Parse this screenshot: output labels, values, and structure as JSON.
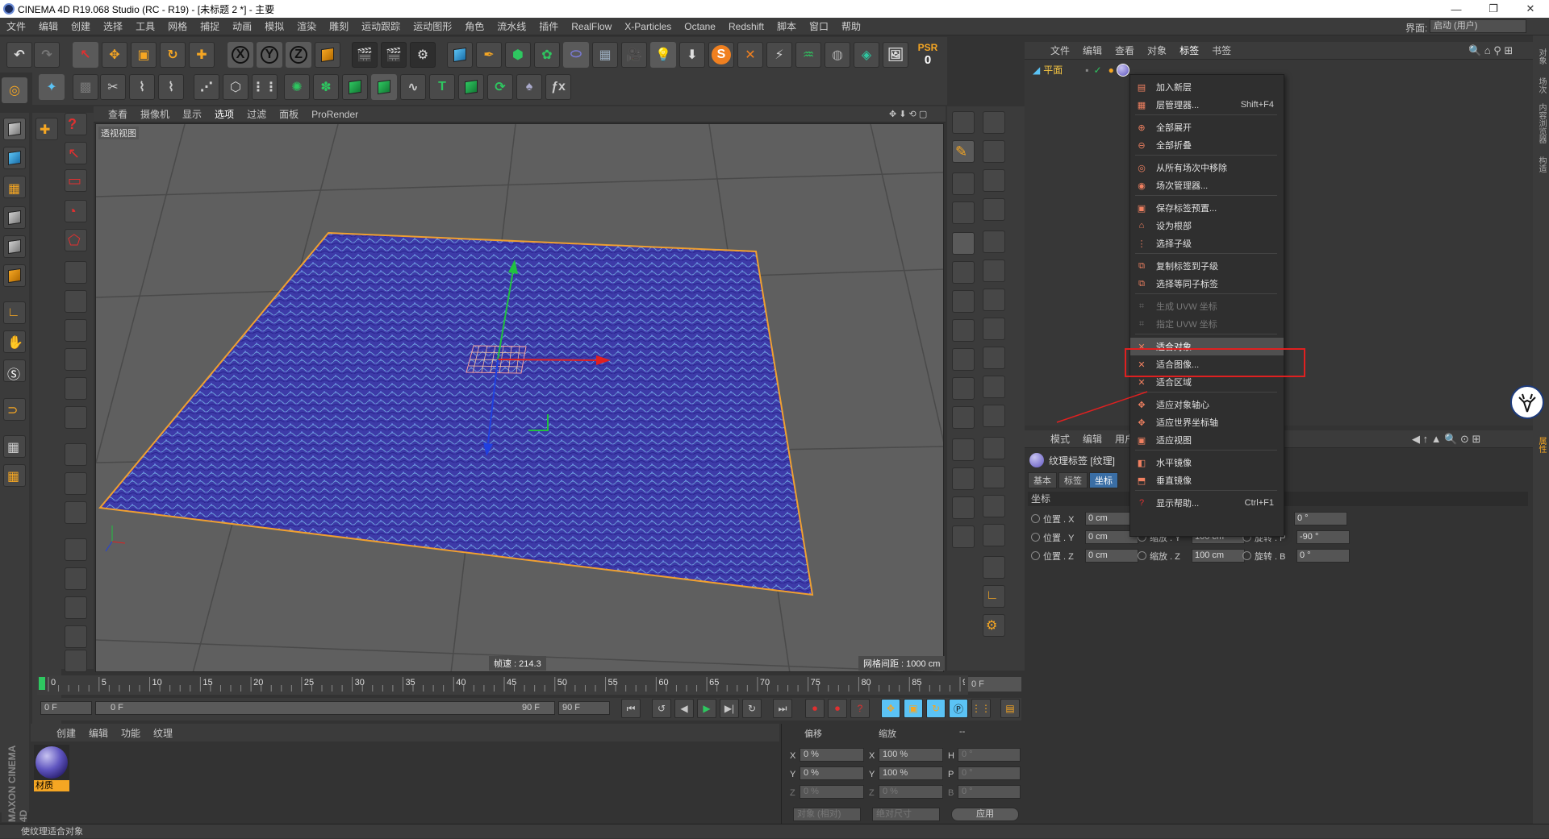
{
  "window": {
    "title": "CINEMA 4D R19.068 Studio (RC - R19) - [未标题 2 *] - 主要",
    "min": "—",
    "restore": "❐",
    "close": "✕"
  },
  "menubar": {
    "items": [
      "文件",
      "编辑",
      "创建",
      "选择",
      "工具",
      "网格",
      "捕捉",
      "动画",
      "模拟",
      "渲染",
      "雕刻",
      "运动跟踪",
      "运动图形",
      "角色",
      "流水线",
      "插件",
      "RealFlow",
      "X-Particles",
      "Octane",
      "Redshift",
      "脚本",
      "窗口",
      "帮助"
    ],
    "layout_label": "界面:",
    "layout_value": "启动 (用户)"
  },
  "toolbar": {
    "psr_label": "PSR",
    "psr_value": "0",
    "x": "X",
    "y": "Y",
    "z": "Z"
  },
  "viewport": {
    "menu": [
      "查看",
      "摄像机",
      "显示",
      "选项",
      "过滤",
      "面板",
      "ProRender"
    ],
    "active": "选项",
    "title": "透视视图",
    "speed": "帧速 : 214.3",
    "grid": "网格间距 : 1000 cm",
    "colors": {
      "plane": "#3d3aa8",
      "edge": "#f0a030",
      "x_axis": "#e02020",
      "y_axis": "#20c040",
      "z_axis": "#2040e0"
    }
  },
  "timeline": {
    "ticks": [
      "0",
      "5",
      "10",
      "15",
      "20",
      "25",
      "30",
      "35",
      "40",
      "45",
      "50",
      "55",
      "60",
      "65",
      "70",
      "75",
      "80",
      "85",
      "90"
    ],
    "current": "0 F"
  },
  "transport": {
    "start": "0 F",
    "range_start": "0 F",
    "range_end": "90 F",
    "end": "90 F"
  },
  "material_manager": {
    "menu": [
      "创建",
      "编辑",
      "功能",
      "纹理"
    ],
    "material_name": "材质"
  },
  "coord_manager": {
    "headers": [
      "偏移",
      "缩放",
      "--"
    ],
    "rows": [
      {
        "axis": "X",
        "off": "0 %",
        "ax2": "X",
        "scale": "100 %",
        "ax3": "H",
        "rot": "0 °"
      },
      {
        "axis": "Y",
        "off": "0 %",
        "ax2": "Y",
        "scale": "100 %",
        "ax3": "P",
        "rot": "0 °"
      },
      {
        "axis": "Z",
        "off": "0 %",
        "ax2": "Z",
        "scale": "0 %",
        "ax3": "B",
        "rot": "0 °"
      }
    ],
    "mode": "对象 (相对)",
    "size_mode": "绝对尺寸",
    "apply": "应用"
  },
  "object_manager": {
    "menu": [
      "文件",
      "编辑",
      "查看",
      "对象",
      "标签",
      "书签"
    ],
    "active": "标签",
    "object_name": "平面"
  },
  "attribute_manager": {
    "menu": [
      "模式",
      "编辑",
      "用户数"
    ],
    "title": "纹理标签 [纹理]",
    "tabs": [
      "基本",
      "标签",
      "坐标"
    ],
    "active_tab": "坐标",
    "section": "坐标",
    "rows": [
      {
        "l1": "位置 . X",
        "v1": "0 cm",
        "l2": "",
        "v2": "",
        "l3": "",
        "v3": "0 °"
      },
      {
        "l1": "位置 . Y",
        "v1": "0 cm",
        "l2": "缩放 . Y",
        "v2": "100 cm",
        "l3": "旋转 . P",
        "v3": "-90 °"
      },
      {
        "l1": "位置 . Z",
        "v1": "0 cm",
        "l2": "缩放 . Z",
        "v2": "100 cm",
        "l3": "旋转 . B",
        "v3": "0 °"
      }
    ]
  },
  "context_menu": {
    "items": [
      {
        "label": "加入新层",
        "shortcut": "",
        "disabled": false,
        "icon": "layer-add-icon"
      },
      {
        "label": "层管理器...",
        "shortcut": "Shift+F4",
        "disabled": false,
        "icon": "layer-manager-icon"
      },
      {
        "label": "全部展开",
        "shortcut": "",
        "disabled": false,
        "icon": "expand-all-icon"
      },
      {
        "label": "全部折叠",
        "shortcut": "",
        "disabled": false,
        "icon": "collapse-all-icon"
      },
      {
        "label": "从所有场次中移除",
        "shortcut": "",
        "disabled": false,
        "icon": "remove-takes-icon"
      },
      {
        "label": "场次管理器...",
        "shortcut": "",
        "disabled": false,
        "icon": "take-manager-icon"
      },
      {
        "label": "保存标签预置...",
        "shortcut": "",
        "disabled": false,
        "icon": "save-preset-icon"
      },
      {
        "label": "设为根部",
        "shortcut": "",
        "disabled": false,
        "icon": "set-root-icon"
      },
      {
        "label": "选择子级",
        "shortcut": "",
        "disabled": false,
        "icon": "select-children-icon"
      },
      {
        "label": "复制标签到子级",
        "shortcut": "",
        "disabled": false,
        "icon": "copy-tag-icon"
      },
      {
        "label": "选择等同子标签",
        "shortcut": "",
        "disabled": false,
        "icon": "select-same-icon"
      },
      {
        "label": "生成 UVW 坐标",
        "shortcut": "",
        "disabled": true,
        "icon": "generate-uvw-icon"
      },
      {
        "label": "指定 UVW 坐标",
        "shortcut": "",
        "disabled": true,
        "icon": "assign-uvw-icon"
      },
      {
        "label": "适合对象",
        "shortcut": "",
        "disabled": false,
        "icon": "fit-object-icon",
        "selected": true
      },
      {
        "label": "适合图像...",
        "shortcut": "",
        "disabled": false,
        "icon": "fit-image-icon"
      },
      {
        "label": "适合区域",
        "shortcut": "",
        "disabled": false,
        "icon": "fit-region-icon"
      },
      {
        "label": "适应对象轴心",
        "shortcut": "",
        "disabled": false,
        "icon": "fit-axis-icon"
      },
      {
        "label": "适应世界坐标轴",
        "shortcut": "",
        "disabled": false,
        "icon": "fit-world-icon"
      },
      {
        "label": "适应视图",
        "shortcut": "",
        "disabled": false,
        "icon": "fit-view-icon"
      },
      {
        "label": "水平镜像",
        "shortcut": "",
        "disabled": false,
        "icon": "mirror-h-icon"
      },
      {
        "label": "垂直镜像",
        "shortcut": "",
        "disabled": false,
        "icon": "mirror-v-icon"
      },
      {
        "label": "显示帮助...",
        "shortcut": "Ctrl+F1",
        "disabled": false,
        "icon": "help-icon"
      }
    ]
  },
  "right_strip": {
    "tabs": [
      "对象",
      "场次",
      "内容浏览器",
      "构造",
      "属性"
    ]
  },
  "status": "使纹理适合对象",
  "maxon": "MAXON CINEMA 4D"
}
